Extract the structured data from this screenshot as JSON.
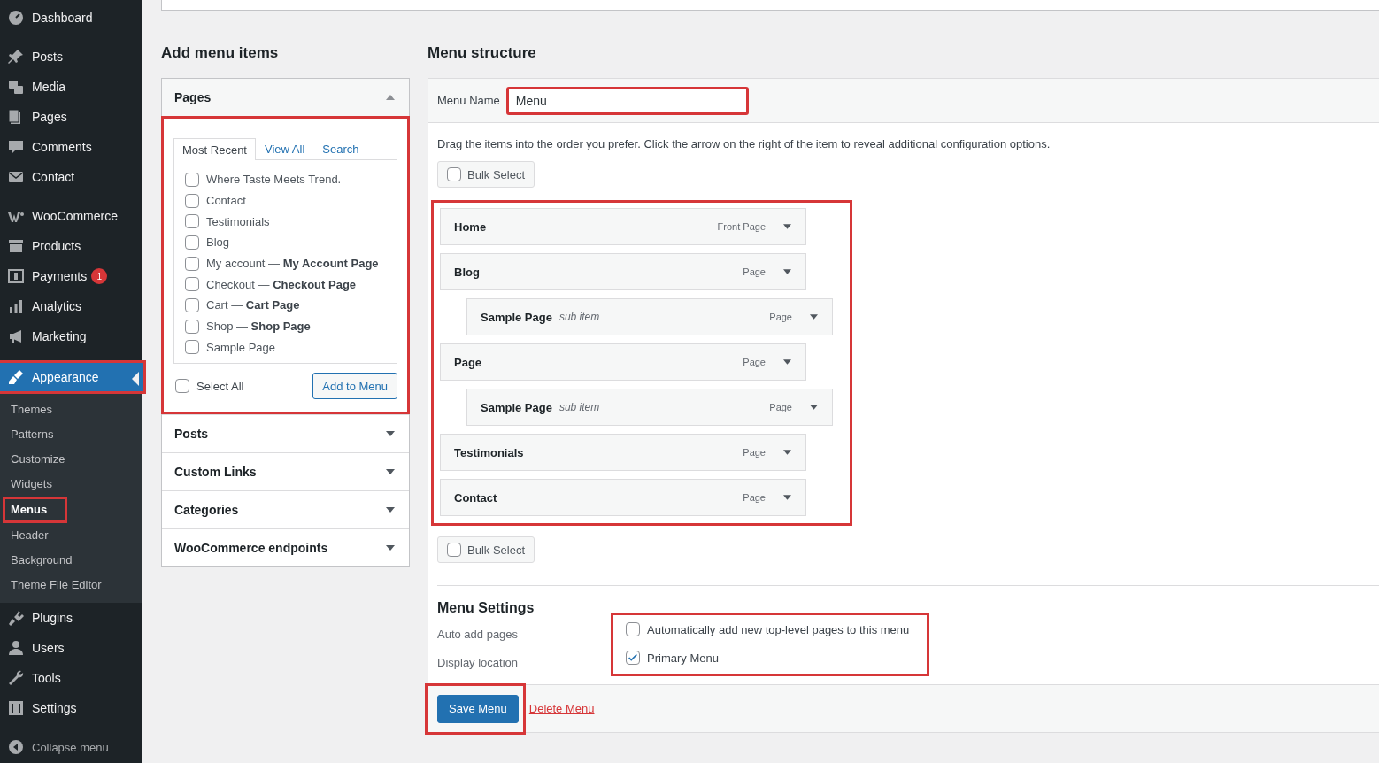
{
  "sidebar": {
    "sections": [
      {
        "items": [
          {
            "label": "Dashboard",
            "selected": false,
            "highlighted": false
          }
        ]
      },
      {
        "items": [
          {
            "label": "Posts",
            "selected": false,
            "highlighted": false
          },
          {
            "label": "Media",
            "selected": false,
            "highlighted": false
          },
          {
            "label": "Pages",
            "selected": false,
            "highlighted": false
          },
          {
            "label": "Comments",
            "selected": false,
            "highlighted": false
          },
          {
            "label": "Contact",
            "selected": false,
            "highlighted": false
          }
        ]
      },
      {
        "items": [
          {
            "label": "WooCommerce",
            "selected": false,
            "highlighted": false
          },
          {
            "label": "Products",
            "selected": false,
            "highlighted": false
          },
          {
            "label": "Payments",
            "selected": false,
            "highlighted": false,
            "badge": "1"
          },
          {
            "label": "Analytics",
            "selected": false,
            "highlighted": false
          },
          {
            "label": "Marketing",
            "selected": false,
            "highlighted": false
          }
        ]
      },
      {
        "items": [
          {
            "label": "Appearance",
            "selected": true,
            "highlighted": true,
            "children": [
              {
                "label": "Themes",
                "selected": false,
                "highlighted": false
              },
              {
                "label": "Patterns",
                "selected": false,
                "highlighted": false
              },
              {
                "label": "Customize",
                "selected": false,
                "highlighted": false
              },
              {
                "label": "Widgets",
                "selected": false,
                "highlighted": false
              },
              {
                "label": "Menus",
                "selected": true,
                "highlighted": true
              },
              {
                "label": "Header",
                "selected": false,
                "highlighted": false
              },
              {
                "label": "Background",
                "selected": false,
                "highlighted": false
              },
              {
                "label": "Theme File Editor",
                "selected": false,
                "highlighted": false
              }
            ]
          },
          {
            "label": "Plugins",
            "selected": false,
            "highlighted": false
          },
          {
            "label": "Users",
            "selected": false,
            "highlighted": false
          },
          {
            "label": "Tools",
            "selected": false,
            "highlighted": false
          },
          {
            "label": "Settings",
            "selected": false,
            "highlighted": false
          }
        ]
      }
    ],
    "collapse_label": "Collapse menu"
  },
  "add_items": {
    "heading": "Add menu items",
    "sections": [
      {
        "title": "Pages",
        "expanded": true,
        "content": {
          "highlighted": true,
          "tabs": [
            {
              "label": "Most Recent",
              "selected": true
            },
            {
              "label": "View All",
              "selected": false
            },
            {
              "label": "Search",
              "selected": false
            }
          ],
          "items": [
            {
              "label": "Where Taste Meets Trend.",
              "checked": false
            },
            {
              "label": "Contact",
              "checked": false
            },
            {
              "label": "Testimonials",
              "checked": false
            },
            {
              "label": "Blog",
              "checked": false
            },
            {
              "label": "My account — **My Account Page**",
              "checked": false
            },
            {
              "label": "Checkout — **Checkout Page**",
              "checked": false
            },
            {
              "label": "Cart — **Cart Page**",
              "checked": false
            },
            {
              "label": "Shop — **Shop Page**",
              "checked": false
            },
            {
              "label": "Sample Page",
              "checked": false
            }
          ],
          "select_all": {
            "label": "Select All",
            "checked": false
          },
          "add_button": "Add to Menu"
        }
      },
      {
        "title": "Posts",
        "expanded": false
      },
      {
        "title": "Custom Links",
        "expanded": false
      },
      {
        "title": "Categories",
        "expanded": false
      },
      {
        "title": "WooCommerce endpoints",
        "expanded": false
      }
    ]
  },
  "structure": {
    "heading": "Menu structure",
    "menu_name": {
      "label": "Menu Name",
      "value": "Menu",
      "highlighted": true
    },
    "instructions": "Drag the items into the order you prefer. Click the arrow on the right of the item to reveal additional configuration options.",
    "bulk_select_top": {
      "label": "Bulk Select",
      "checked": false
    },
    "items_highlighted": true,
    "items": [
      {
        "title": "Home",
        "type": "Front Page"
      },
      {
        "title": "Blog",
        "type": "Page",
        "children": [
          {
            "title": "Sample Page",
            "note": "sub item",
            "type": "Page"
          }
        ]
      },
      {
        "title": "Page",
        "type": "Page",
        "children": [
          {
            "title": "Sample Page",
            "note": "sub item",
            "type": "Page"
          }
        ]
      },
      {
        "title": "Testimonials",
        "type": "Page"
      },
      {
        "title": "Contact",
        "type": "Page"
      }
    ],
    "bulk_select_bottom": {
      "label": "Bulk Select",
      "checked": false
    },
    "settings": {
      "heading": "Menu Settings",
      "highlighted": true,
      "rows": [
        {
          "label": "Auto add pages",
          "option": "Automatically add new top-level pages to this menu",
          "checked": false
        },
        {
          "label": "Display location",
          "option": "Primary Menu",
          "checked": true
        }
      ]
    },
    "save_button": {
      "label": "Save Menu",
      "highlighted": true
    },
    "delete_link": "Delete Menu"
  }
}
